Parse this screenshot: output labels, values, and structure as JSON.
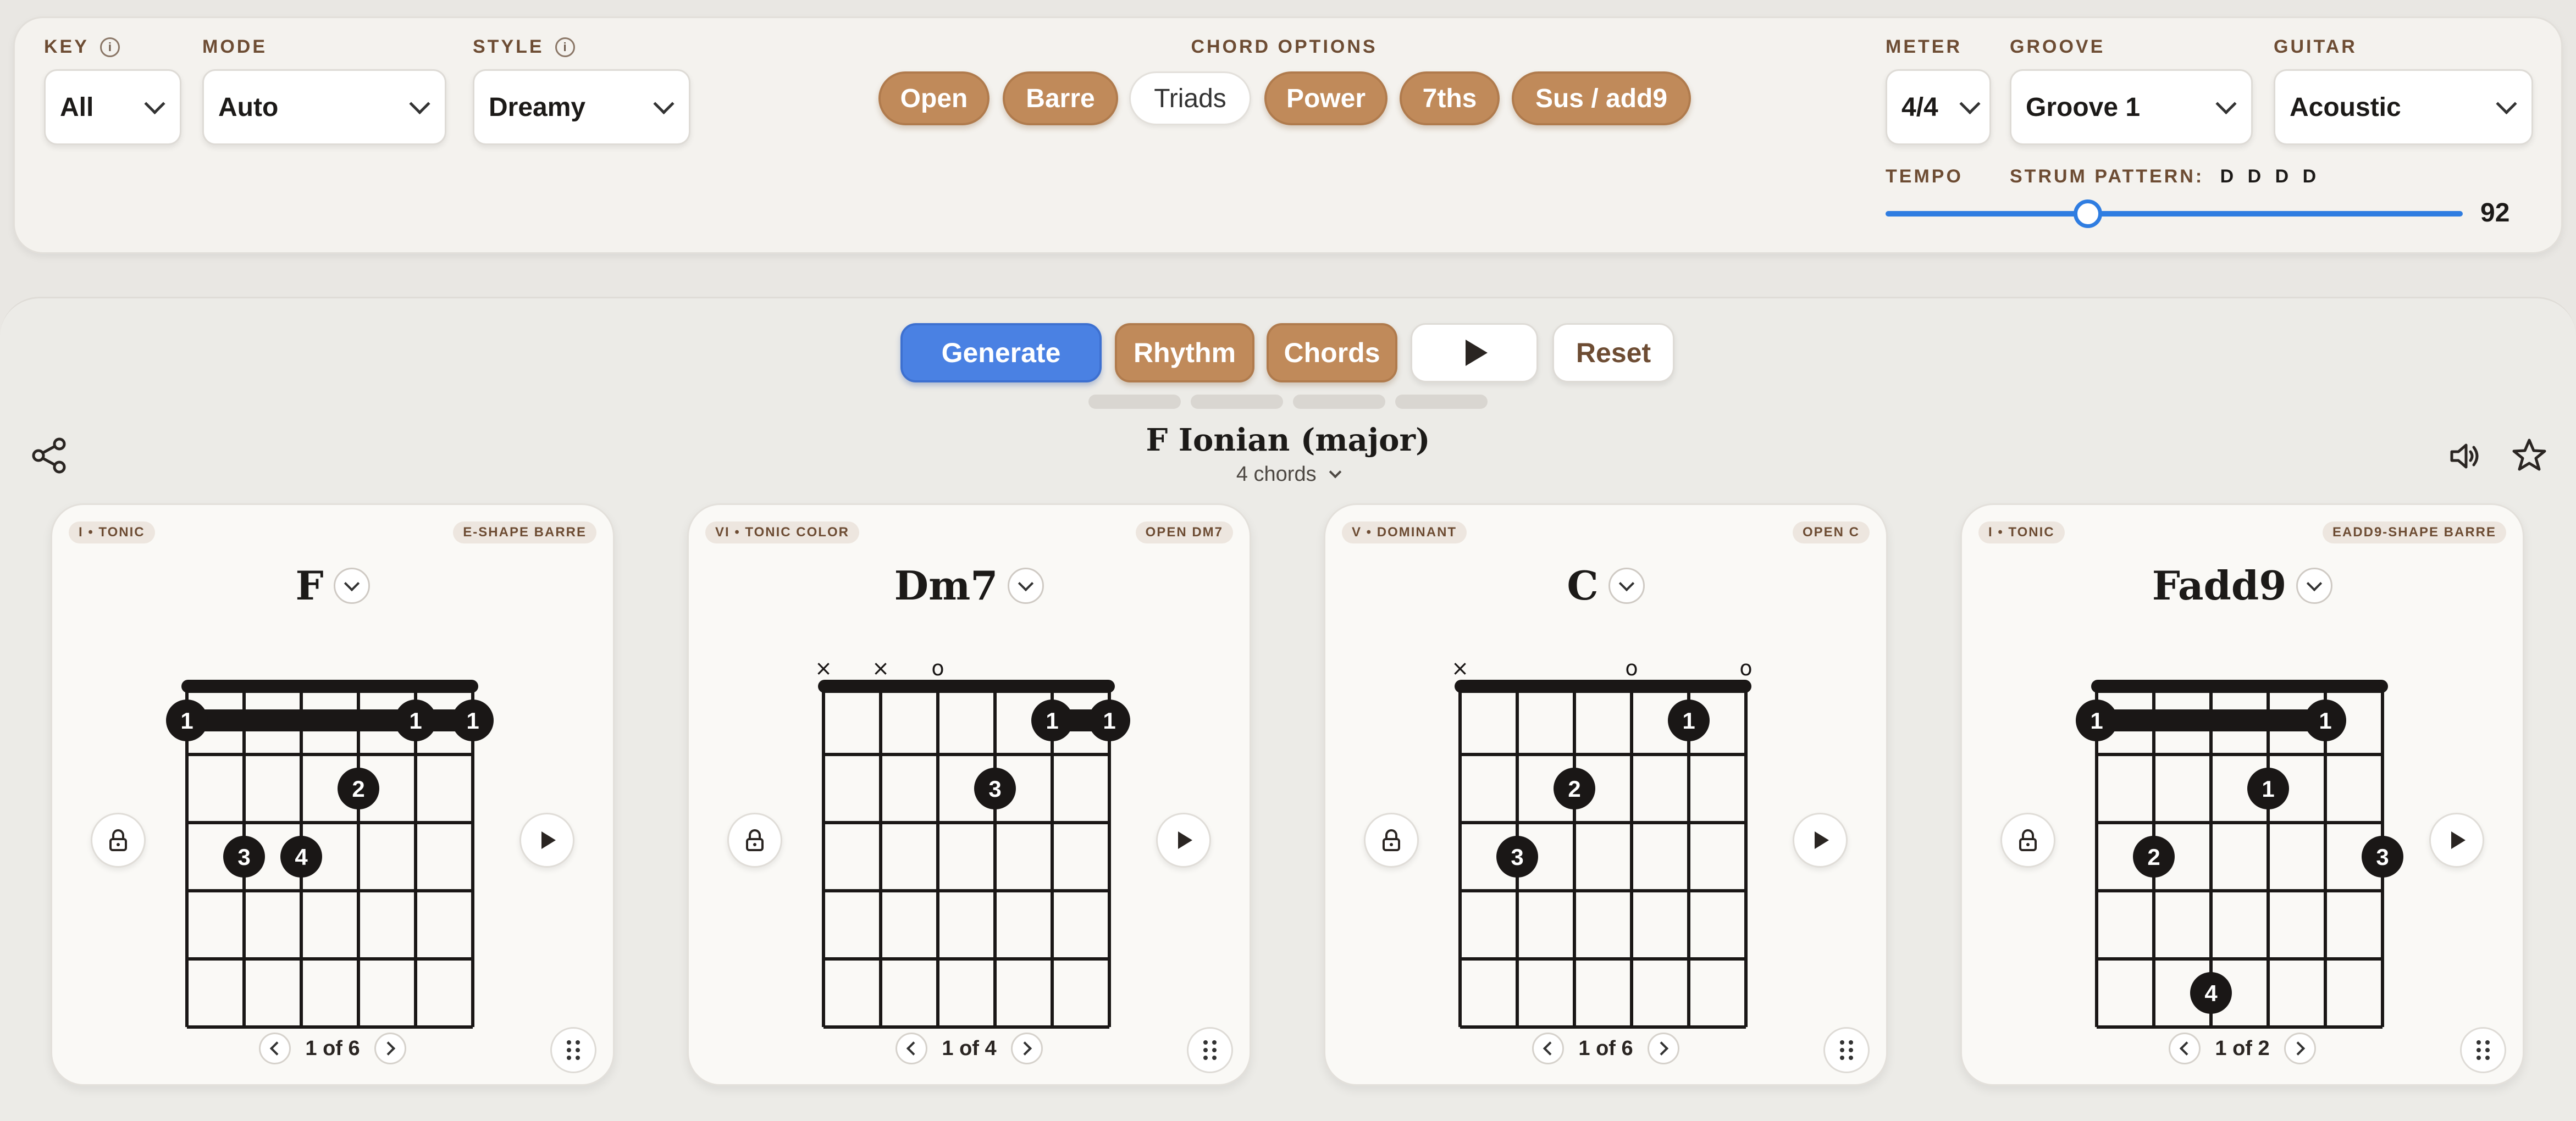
{
  "settings": {
    "key": {
      "label": "KEY",
      "value": "All",
      "info_icon": "info-icon"
    },
    "mode": {
      "label": "MODE",
      "value": "Auto"
    },
    "style": {
      "label": "STYLE",
      "value": "Dreamy",
      "info_icon": "info-icon"
    },
    "chord_options": {
      "label": "CHORD OPTIONS",
      "items": [
        {
          "label": "Open",
          "active": true
        },
        {
          "label": "Barre",
          "active": true
        },
        {
          "label": "Triads",
          "active": false
        },
        {
          "label": "Power",
          "active": true
        },
        {
          "label": "7ths",
          "active": true
        },
        {
          "label": "Sus / add9",
          "active": true
        }
      ]
    },
    "meter": {
      "label": "METER",
      "value": "4/4"
    },
    "groove": {
      "label": "GROOVE",
      "value": "Groove 1"
    },
    "guitar": {
      "label": "GUITAR",
      "value": "Acoustic"
    },
    "tempo": {
      "label": "TEMPO",
      "value": "92"
    },
    "strum": {
      "label": "STRUM PATTERN:",
      "value": "D D D D"
    }
  },
  "actions": {
    "generate": "Generate",
    "rhythm": "Rhythm",
    "chords": "Chords",
    "play_icon": "play-icon",
    "reset": "Reset"
  },
  "progression": {
    "title": "F Ionian (major)",
    "subtitle": "4 chords",
    "icons": {
      "share": "share-icon",
      "volume": "volume-icon",
      "favorite": "star-icon"
    }
  },
  "colors": {
    "accent_brown": "#c08a5a",
    "primary_blue": "#4a81e3",
    "slider_blue": "#2f7de1",
    "dot_black": "#1a1716"
  },
  "chords": [
    {
      "name": "F",
      "tag_left": "I • TONIC",
      "tag_right": "E-SHAPE BARRE",
      "pager": "1 of 6",
      "string_marks": [
        "",
        "",
        "",
        "",
        "",
        ""
      ],
      "barre": {
        "fret": 1,
        "from_string": 0,
        "to_string": 5
      },
      "dots": [
        {
          "string": 0,
          "fret": 1,
          "finger": "1"
        },
        {
          "string": 4,
          "fret": 1,
          "finger": "1"
        },
        {
          "string": 5,
          "fret": 1,
          "finger": "1"
        },
        {
          "string": 3,
          "fret": 2,
          "finger": "2"
        },
        {
          "string": 1,
          "fret": 3,
          "finger": "3"
        },
        {
          "string": 2,
          "fret": 3,
          "finger": "4"
        }
      ]
    },
    {
      "name": "Dm7",
      "tag_left": "VI • TONIC COLOR",
      "tag_right": "OPEN DM7",
      "pager": "1 of 4",
      "string_marks": [
        "×",
        "×",
        "o",
        "",
        "",
        ""
      ],
      "barre": {
        "fret": 1,
        "from_string": 4,
        "to_string": 5
      },
      "dots": [
        {
          "string": 4,
          "fret": 1,
          "finger": "1"
        },
        {
          "string": 5,
          "fret": 1,
          "finger": "1"
        },
        {
          "string": 3,
          "fret": 2,
          "finger": "3"
        }
      ]
    },
    {
      "name": "C",
      "tag_left": "V • DOMINANT",
      "tag_right": "OPEN C",
      "pager": "1 of 6",
      "string_marks": [
        "×",
        "",
        "",
        "o",
        "",
        "o"
      ],
      "barre": null,
      "dots": [
        {
          "string": 4,
          "fret": 1,
          "finger": "1"
        },
        {
          "string": 2,
          "fret": 2,
          "finger": "2"
        },
        {
          "string": 1,
          "fret": 3,
          "finger": "3"
        }
      ]
    },
    {
      "name": "Fadd9",
      "tag_left": "I • TONIC",
      "tag_right": "EADD9-SHAPE BARRE",
      "pager": "1 of 2",
      "string_marks": [
        "",
        "",
        "",
        "",
        "",
        ""
      ],
      "barre": {
        "fret": 1,
        "from_string": 0,
        "to_string": 4
      },
      "dots": [
        {
          "string": 0,
          "fret": 1,
          "finger": "1"
        },
        {
          "string": 4,
          "fret": 1,
          "finger": "1"
        },
        {
          "string": 3,
          "fret": 2,
          "finger": "1"
        },
        {
          "string": 1,
          "fret": 3,
          "finger": "2"
        },
        {
          "string": 5,
          "fret": 3,
          "finger": "3"
        },
        {
          "string": 2,
          "fret": 5,
          "finger": "4"
        }
      ]
    }
  ]
}
